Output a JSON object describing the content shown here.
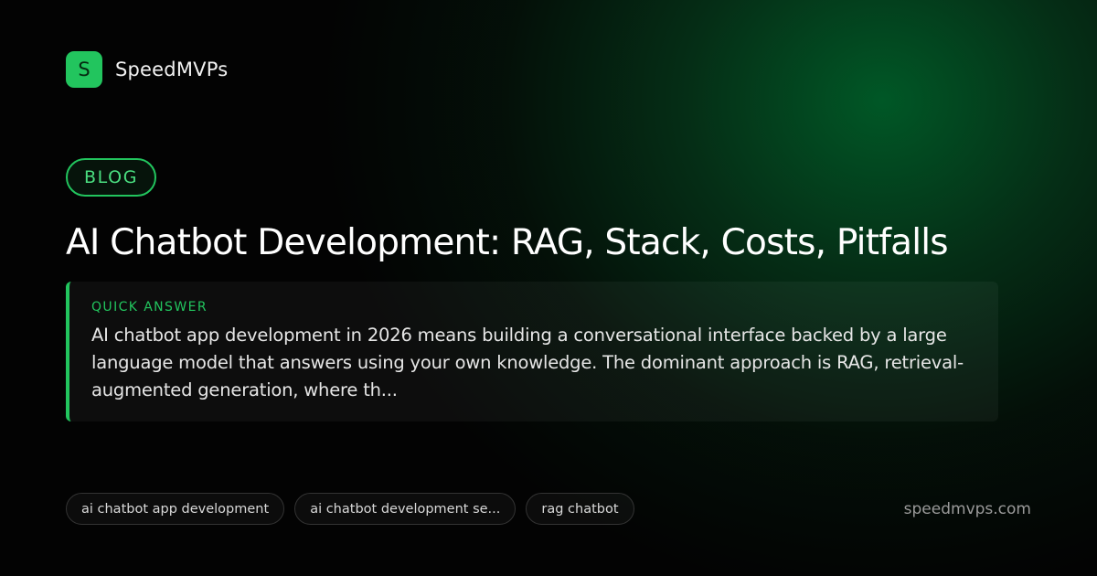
{
  "brand": {
    "logo_letter": "S",
    "name": "SpeedMVPs"
  },
  "category": "BLOG",
  "title": "AI Chatbot Development: RAG, Stack, Costs, Pitfalls",
  "quick_answer": {
    "label": "QUICK ANSWER",
    "text": "AI chatbot app development in 2026 means building a conversational interface backed by a large language model that answers using your own knowledge. The dominant approach is RAG, retrieval-augmented generation, where th..."
  },
  "tags": [
    "ai chatbot app development",
    "ai chatbot development se...",
    "rag chatbot"
  ],
  "site_url": "speedmvps.com",
  "colors": {
    "accent": "#22c55e",
    "background": "#030303",
    "glow": "#005c28"
  }
}
